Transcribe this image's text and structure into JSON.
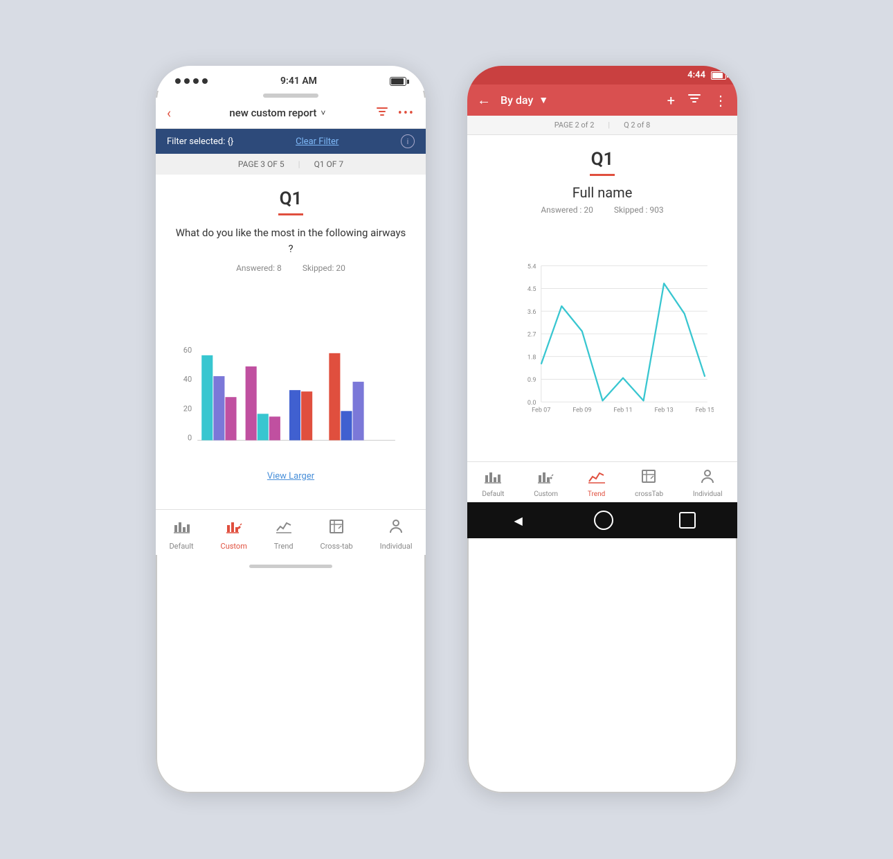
{
  "ios": {
    "status": {
      "time": "9:41 AM"
    },
    "navbar": {
      "title": "new custom report",
      "back_label": "‹",
      "filter_icon": "filter",
      "more_icon": "•••"
    },
    "filter_bar": {
      "filter_text": "Filter selected: {}",
      "clear_label": "Clear Filter",
      "info_label": "i"
    },
    "page_bar": {
      "page_label": "PAGE 3  OF 5",
      "question_label": "Q1  OF 7",
      "divider": "|"
    },
    "question": {
      "title": "Q1",
      "text": "What do you like the most in the following airways ?",
      "answered_label": "Answered: 8",
      "skipped_label": "Skipped: 20"
    },
    "chart": {
      "y_max": 60,
      "y_labels": [
        "0",
        "20",
        "40",
        "60"
      ],
      "groups": [
        {
          "bars": [
            58,
            44,
            29
          ],
          "colors": [
            "#38c6d0",
            "#7b78d8",
            "#d060b0"
          ]
        },
        {
          "bars": [
            51,
            18,
            15
          ],
          "colors": [
            "#d060b0",
            "#38c6d0",
            "#d060b0"
          ]
        },
        {
          "bars": [
            35,
            34,
            0
          ],
          "colors": [
            "#4060d0",
            "#e04f3e",
            "#0000"
          ]
        },
        {
          "bars": [
            60,
            20,
            40
          ],
          "colors": [
            "#e04f3e",
            "#4060d0",
            "#7b78d8"
          ]
        }
      ]
    },
    "view_larger": "View Larger",
    "bottom_nav": {
      "items": [
        {
          "label": "Default",
          "icon": "bar-chart",
          "active": false
        },
        {
          "label": "Custom",
          "icon": "edit-chart",
          "active": true
        },
        {
          "label": "Trend",
          "icon": "line-chart",
          "active": false
        },
        {
          "label": "Cross-tab",
          "icon": "crosstab",
          "active": false
        },
        {
          "label": "Individual",
          "icon": "person",
          "active": false
        }
      ]
    }
  },
  "android": {
    "status": {
      "time": "4:44"
    },
    "toolbar": {
      "title": "By day",
      "back_label": "←",
      "add_icon": "+",
      "filter_icon": "▼",
      "more_icon": "⋮"
    },
    "page_bar": {
      "page_label": "PAGE 2 of 2",
      "question_label": "Q 2 of 8",
      "divider": "|"
    },
    "question": {
      "title": "Q1",
      "subtitle": "Full name",
      "answered_label": "Answered : 20",
      "skipped_label": "Skipped : 903"
    },
    "chart": {
      "y_labels": [
        "0.0",
        "0.9",
        "1.8",
        "2.7",
        "3.6",
        "4.5",
        "5.4"
      ],
      "x_labels": [
        "Feb 07",
        "Feb 09",
        "Feb 11",
        "Feb 13",
        "Feb 15"
      ],
      "points": [
        {
          "x": 0,
          "y": 1.5
        },
        {
          "x": 1,
          "y": 3.8
        },
        {
          "x": 2,
          "y": 2.8
        },
        {
          "x": 3,
          "y": 0.05
        },
        {
          "x": 4,
          "y": 0.95
        },
        {
          "x": 5,
          "y": 0.05
        },
        {
          "x": 6,
          "y": 4.7
        },
        {
          "x": 7,
          "y": 3.5
        },
        {
          "x": 8,
          "y": 1.0
        }
      ],
      "line_color": "#38c6d0"
    },
    "bottom_nav": {
      "items": [
        {
          "label": "Default",
          "icon": "bar-chart",
          "active": false
        },
        {
          "label": "Custom",
          "icon": "edit-chart",
          "active": false
        },
        {
          "label": "Trend",
          "icon": "trend-chart",
          "active": true
        },
        {
          "label": "crossTab",
          "icon": "crosstab",
          "active": false
        },
        {
          "label": "Individual",
          "icon": "person",
          "active": false
        }
      ]
    },
    "system_bar": {
      "back_label": "◀",
      "home_label": "●",
      "recent_label": "■"
    }
  }
}
